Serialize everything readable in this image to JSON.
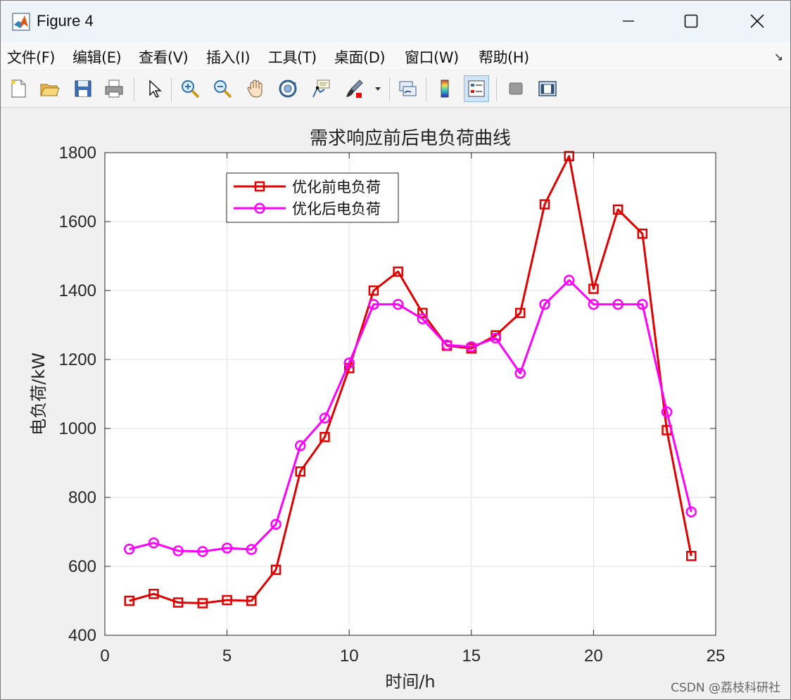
{
  "window": {
    "title": "Figure 4",
    "controls": [
      "minimize",
      "maximize",
      "close"
    ]
  },
  "menu": {
    "items": [
      {
        "label": "文件(F)"
      },
      {
        "label": "编辑(E)"
      },
      {
        "label": "查看(V)"
      },
      {
        "label": "插入(I)"
      },
      {
        "label": "工具(T)"
      },
      {
        "label": "桌面(D)"
      },
      {
        "label": "窗口(W)"
      },
      {
        "label": "帮助(H)"
      }
    ],
    "dock_icon": "dock-arrow-icon"
  },
  "toolbar": {
    "tools": [
      {
        "icon": "new-figure-icon"
      },
      {
        "icon": "open-file-icon"
      },
      {
        "icon": "save-icon"
      },
      {
        "icon": "print-icon"
      },
      {
        "icon": "pointer-icon"
      },
      {
        "icon": "zoom-in-icon"
      },
      {
        "icon": "zoom-out-icon"
      },
      {
        "icon": "pan-hand-icon"
      },
      {
        "icon": "rotate-3d-icon"
      },
      {
        "icon": "data-cursor-icon"
      },
      {
        "icon": "brush-icon"
      },
      {
        "icon": "link-plot-icon"
      },
      {
        "icon": "colorbar-icon"
      },
      {
        "icon": "legend-icon"
      },
      {
        "icon": "hide-plot-tools-icon"
      },
      {
        "icon": "show-plot-tools-icon"
      }
    ]
  },
  "watermark": "CSDN @荔枝科研社",
  "colors": {
    "series_before": "#e00000",
    "series_after": "#ff00ff",
    "axes_background": "#ffffff",
    "grid": "#e1e1e1"
  },
  "chart_data": {
    "type": "line",
    "title": "需求响应前后电负荷曲线",
    "xlabel": "时间/h",
    "ylabel": "电负荷/kW",
    "xlim": [
      0,
      25
    ],
    "ylim": [
      400,
      1800
    ],
    "xticks": [
      0,
      5,
      10,
      15,
      20,
      25
    ],
    "yticks": [
      400,
      600,
      800,
      1000,
      1200,
      1400,
      1600,
      1800
    ],
    "grid": true,
    "legend_position": "top-left",
    "x": [
      1,
      2,
      3,
      4,
      5,
      6,
      7,
      8,
      9,
      10,
      11,
      12,
      13,
      14,
      15,
      16,
      17,
      18,
      19,
      20,
      21,
      22,
      23,
      24
    ],
    "series": [
      {
        "name": "优化前电负荷",
        "color": "#e00000",
        "marker": "square",
        "values": [
          500,
          520,
          495,
          493,
          502,
          500,
          590,
          875,
          975,
          1175,
          1400,
          1455,
          1335,
          1240,
          1232,
          1270,
          1335,
          1650,
          1790,
          1405,
          1635,
          1565,
          995,
          630
        ]
      },
      {
        "name": "优化后电负荷",
        "color": "#ff00ff",
        "marker": "circle",
        "values": [
          650,
          668,
          645,
          643,
          653,
          649,
          722,
          950,
          1030,
          1190,
          1360,
          1360,
          1318,
          1242,
          1237,
          1262,
          1160,
          1360,
          1430,
          1360,
          1360,
          1360,
          1048,
          758
        ]
      }
    ]
  }
}
